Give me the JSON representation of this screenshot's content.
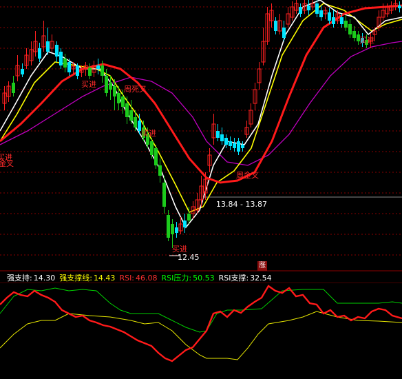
{
  "colors": {
    "bg": "#000000",
    "grid": "#8b0000",
    "up": "#ff2020",
    "down": "#1ccb1c",
    "doji": "#00e5ff",
    "ma_white": "#ffffff",
    "ma_yellow": "#ffff00",
    "ma_red": "#ff1a1a",
    "ma_purple": "#c000c0",
    "indicator_green": "#00d000",
    "indicator_yellow": "#e6e600",
    "indicator_red": "#ff1a1a",
    "info_white": "#ffffff",
    "info_yellow": "#ffff00",
    "info_red": "#ff3030",
    "info_green": "#00ff00"
  },
  "annotations": {
    "buy_left": "买进",
    "golden_cross_left": "金叉",
    "buy_mid": "买进",
    "weekly_death_cross": "周死叉",
    "buy_mid2": "买进",
    "price_range": "13.84 - 13.87",
    "buy_bottom": "买进",
    "low_price": "12.45",
    "weekly_golden_cross": "周金叉",
    "buy_right": "买进"
  },
  "badge": {
    "label": "涨"
  },
  "indicator": {
    "strong_support_label": "强支持:",
    "strong_support_value": "14.30",
    "support_line_label": "强支撑线:",
    "support_line_value": "14.43",
    "rsi_label": "RSI:",
    "rsi_value": "46.08",
    "rsi_pressure_label": "RSI压力:",
    "rsi_pressure_value": "50.53",
    "rsi_support_label": "RSI支撑:",
    "rsi_support_value": "32.54"
  }
}
